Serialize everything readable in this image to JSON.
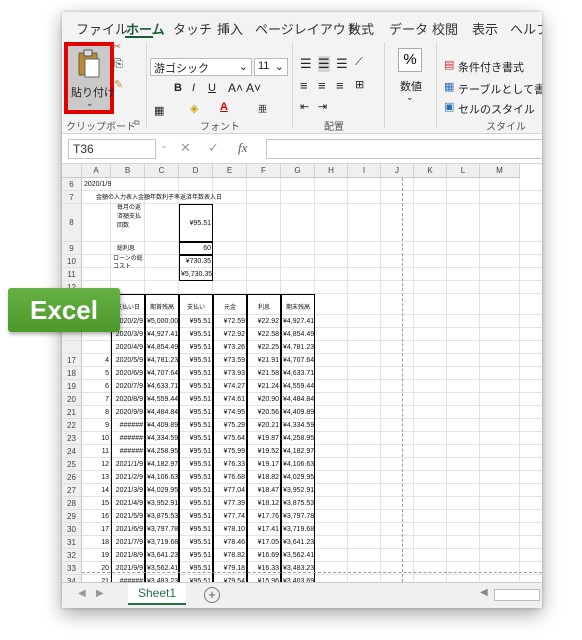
{
  "tabs": [
    "ファイル",
    "ホーム",
    "タッチ",
    "挿入",
    "ページレイアウト",
    "数式",
    "データ",
    "校閲",
    "表示",
    "ヘルプ"
  ],
  "ribbon": {
    "paste_label": "貼り付け",
    "clipboard_label": "クリップボード",
    "font_name": "游ゴシック",
    "font_size": "11",
    "font_group_label": "フォント",
    "align_group_label": "配置",
    "number_label": "数値",
    "number_symbol": "%",
    "cond_format": "条件付き書式",
    "table_format": "テーブルとして書式設定",
    "cell_style": "セルのスタイル",
    "style_group_label": "スタイル"
  },
  "formula_bar": {
    "name_box": "T36",
    "fx": "fx",
    "cancel": "✕",
    "enter": "✓"
  },
  "columns": [
    "A",
    "B",
    "C",
    "D",
    "E",
    "F",
    "G",
    "H",
    "I",
    "J",
    "K",
    "L",
    "M"
  ],
  "sheet": {
    "a6": "2020/1/9",
    "heading7": "金額の入力表入金額年数利子率返済年数表入日",
    "label8": "毎月の返済額支払回数",
    "d8": "¥95.51",
    "label9": "総利息",
    "d9": "60",
    "label10": "ローンの総コスト",
    "d10": "¥730.35",
    "d11": "¥5,730.35",
    "headers": [
      "支払い日",
      "期首残高",
      "支払い",
      "元金",
      "利息",
      "期末残高"
    ],
    "rows": [
      {
        "r": "14",
        "n": "",
        "date": "2020/2/9",
        "open": "¥5,000.00",
        "pay": "¥95.51",
        "prin": "¥72.59",
        "int": "¥22.92",
        "close": "¥4,927.41"
      },
      {
        "r": "15",
        "n": "",
        "date": "2020/3/9",
        "open": "¥4,927.41",
        "pay": "¥95.51",
        "prin": "¥72.92",
        "int": "¥22.58",
        "close": "¥4,854.49"
      },
      {
        "r": "16",
        "n": "",
        "date": "2020/4/9",
        "open": "¥4,854.49",
        "pay": "¥95.51",
        "prin": "¥73.26",
        "int": "¥22.25",
        "close": "¥4,781.23"
      },
      {
        "r": "17",
        "n": "4",
        "date": "2020/5/9",
        "open": "¥4,781.23",
        "pay": "¥95.51",
        "prin": "¥73.59",
        "int": "¥21.91",
        "close": "¥4,707.64"
      },
      {
        "r": "18",
        "n": "5",
        "date": "2020/6/9",
        "open": "¥4,707.64",
        "pay": "¥95.51",
        "prin": "¥73.93",
        "int": "¥21.58",
        "close": "¥4,633.71"
      },
      {
        "r": "19",
        "n": "6",
        "date": "2020/7/9",
        "open": "¥4,633.71",
        "pay": "¥95.51",
        "prin": "¥74.27",
        "int": "¥21.24",
        "close": "¥4,559.44"
      },
      {
        "r": "20",
        "n": "7",
        "date": "2020/8/9",
        "open": "¥4,559.44",
        "pay": "¥95.51",
        "prin": "¥74.61",
        "int": "¥20.90",
        "close": "¥4,484.84"
      },
      {
        "r": "21",
        "n": "8",
        "date": "2020/9/9",
        "open": "¥4,484.84",
        "pay": "¥95.51",
        "prin": "¥74.95",
        "int": "¥20.56",
        "close": "¥4,409.89"
      },
      {
        "r": "22",
        "n": "9",
        "date": "######",
        "open": "¥4,409.89",
        "pay": "¥95.51",
        "prin": "¥75.29",
        "int": "¥20.21",
        "close": "¥4,334.59"
      },
      {
        "r": "23",
        "n": "10",
        "date": "######",
        "open": "¥4,334.59",
        "pay": "¥95.51",
        "prin": "¥75.64",
        "int": "¥19.87",
        "close": "¥4,258.95"
      },
      {
        "r": "24",
        "n": "11",
        "date": "######",
        "open": "¥4,258.95",
        "pay": "¥95.51",
        "prin": "¥75.99",
        "int": "¥19.52",
        "close": "¥4,182.97"
      },
      {
        "r": "25",
        "n": "12",
        "date": "2021/1/9",
        "open": "¥4,182.97",
        "pay": "¥95.51",
        "prin": "¥76.33",
        "int": "¥19.17",
        "close": "¥4,106.63"
      },
      {
        "r": "26",
        "n": "13",
        "date": "2021/2/9",
        "open": "¥4,106.63",
        "pay": "¥95.51",
        "prin": "¥76.68",
        "int": "¥18.82",
        "close": "¥4,029.95"
      },
      {
        "r": "27",
        "n": "14",
        "date": "2021/3/9",
        "open": "¥4,029.95",
        "pay": "¥95.51",
        "prin": "¥77.04",
        "int": "¥18.47",
        "close": "¥3,952.91"
      },
      {
        "r": "28",
        "n": "15",
        "date": "2021/4/9",
        "open": "¥3,952.91",
        "pay": "¥95.51",
        "prin": "¥77.39",
        "int": "¥18.12",
        "close": "¥3,875.53"
      },
      {
        "r": "29",
        "n": "16",
        "date": "2021/5/9",
        "open": "¥3,875.53",
        "pay": "¥95.51",
        "prin": "¥77.74",
        "int": "¥17.76",
        "close": "¥3,797.78"
      },
      {
        "r": "30",
        "n": "17",
        "date": "2021/6/9",
        "open": "¥3,797.78",
        "pay": "¥95.51",
        "prin": "¥78.10",
        "int": "¥17.41",
        "close": "¥3,719.68"
      },
      {
        "r": "31",
        "n": "18",
        "date": "2021/7/9",
        "open": "¥3,719.68",
        "pay": "¥95.51",
        "prin": "¥78.46",
        "int": "¥17.05",
        "close": "¥3,641.23"
      },
      {
        "r": "32",
        "n": "19",
        "date": "2021/8/9",
        "open": "¥3,641.23",
        "pay": "¥95.51",
        "prin": "¥78.82",
        "int": "¥16.69",
        "close": "¥3,562.41"
      },
      {
        "r": "33",
        "n": "20",
        "date": "2021/9/9",
        "open": "¥3,562.41",
        "pay": "¥95.51",
        "prin": "¥79.18",
        "int": "¥16.33",
        "close": "¥3,483.23"
      },
      {
        "r": "34",
        "n": "21",
        "date": "######",
        "open": "¥3,483.23",
        "pay": "¥95.51",
        "prin": "¥79.54",
        "int": "¥15.96",
        "close": "¥3,403.69"
      },
      {
        "r": "35",
        "n": "22",
        "date": "######",
        "open": "¥3,403.69",
        "pay": "¥95.51",
        "prin": "¥79.91",
        "int": "¥15.60",
        "close": "¥3,323.78"
      },
      {
        "r": "36",
        "n": "23",
        "date": "######",
        "open": "¥3,323.78",
        "pay": "¥95.51",
        "prin": "¥80.27",
        "int": "¥15.23",
        "close": "¥3,243.51"
      }
    ]
  },
  "sheet_tab": "Sheet1",
  "add_sheet": "+",
  "badge": "Excel",
  "colors": {
    "accent": "#185c37",
    "badge": "#5aa637",
    "highlight": "#e10000"
  }
}
